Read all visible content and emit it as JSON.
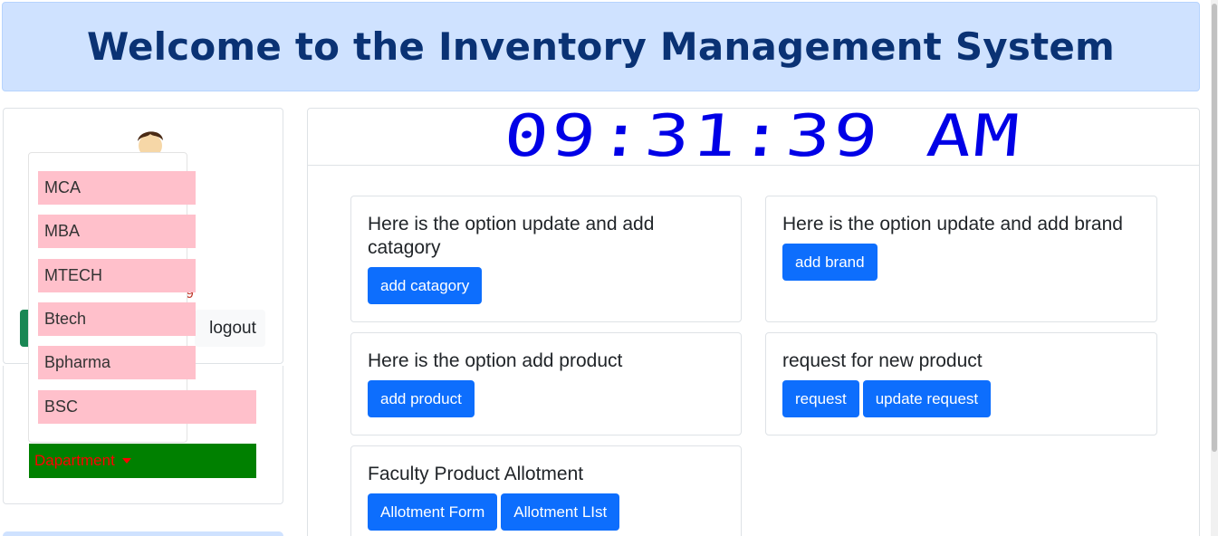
{
  "header": {
    "title": "Welcome to the Inventory Management System"
  },
  "clock": {
    "time": "09:31:39 AM"
  },
  "profile": {
    "avatar_icon": "user-avatar-icon",
    "stray_text": "9",
    "logout_label": "logout"
  },
  "department": {
    "toggle_label": "Dapartment",
    "items": [
      "MCA",
      "MBA",
      "MTECH",
      "Btech",
      "Bpharma",
      "BSC"
    ]
  },
  "options": [
    {
      "title": "Here is the option update and add catagory",
      "buttons": [
        "add catagory"
      ]
    },
    {
      "title": "Here is the option update and add brand",
      "buttons": [
        "add brand"
      ]
    },
    {
      "title": "Here is the option add product",
      "buttons": [
        "add product"
      ]
    },
    {
      "title": "request for new product",
      "buttons": [
        "request",
        "update request"
      ]
    },
    {
      "title": "Faculty Product Allotment",
      "buttons": [
        "Allotment Form",
        "Allotment LIst"
      ]
    }
  ],
  "colors": {
    "header_bg": "#cfe2ff",
    "header_text": "#0a3274",
    "primary": "#0d6efd",
    "clock": "#0000e6",
    "dept_item_bg": "#ffc0cb",
    "dept_toggle_bg": "#008000",
    "dept_toggle_text": "#ff0000"
  }
}
